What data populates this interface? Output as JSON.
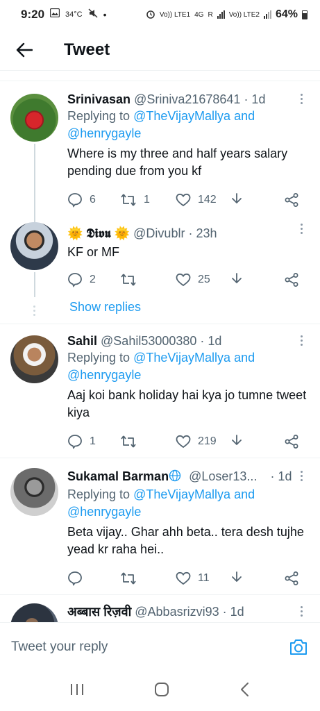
{
  "status_bar": {
    "time": "9:20",
    "temp": "34°C",
    "network1": "Vo)) LTE1",
    "network2": "4G",
    "network3": "R",
    "network4": "Vo)) LTE2",
    "battery": "64%"
  },
  "header": {
    "title": "Tweet"
  },
  "tweets": [
    {
      "name": "Srinivasan",
      "handle": "@Sriniva21678641 · 1d",
      "replying_label": "Replying to",
      "mention1": "@TheVijayMallya",
      "and": "and",
      "mention2": "@henrygayle",
      "text": "Where is my three and half years salary pending due from you kf",
      "replies": "6",
      "retweets": "1",
      "likes": "142"
    },
    {
      "name_prefix": "🌞",
      "name": "𝕯𝖎𝖛𝖚",
      "name_suffix": "🌞",
      "handle": "@Divublr · 23h",
      "text": "KF or MF",
      "replies": "2",
      "retweets": "",
      "likes": "25"
    },
    {
      "name": "Sahil",
      "handle": "@Sahil53000380 · 1d",
      "replying_label": "Replying to",
      "mention1": "@TheVijayMallya",
      "and": "and",
      "mention2": "@henrygayle",
      "text": "Aaj koi bank holiday hai kya jo tumne tweet kiya",
      "replies": "1",
      "retweets": "",
      "likes": "219"
    },
    {
      "name": "Sukamal Barman",
      "handle": "@Loser13...",
      "time": "· 1d",
      "replying_label": "Replying to",
      "mention1": "@TheVijayMallya",
      "and": "and",
      "mention2": "@henrygayle",
      "text": "Beta vijay.. Ghar ahh beta.. tera desh tujhe yead kr raha hei..",
      "replies": "",
      "retweets": "",
      "likes": "11"
    },
    {
      "name": "अब्बास रिज़वी",
      "handle": "@Abbasrizvi93 · 1d"
    }
  ],
  "show_replies": "Show replies",
  "reply_bar": {
    "placeholder": "Tweet your reply"
  },
  "colors": {
    "accent": "#1d9bf0",
    "secondary_text": "#536471",
    "divider": "#eff3f4"
  }
}
